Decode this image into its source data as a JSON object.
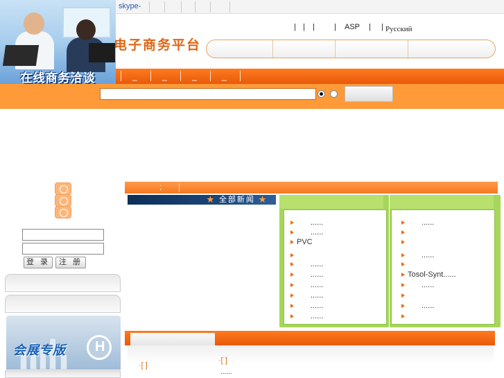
{
  "topbar": {
    "skype": "skype-"
  },
  "promo": {
    "title": "在线商务洽谈"
  },
  "header": {
    "logo": "电子商务平台",
    "link_asp": "ASP",
    "link_ru": "Русский",
    "pipes": [
      "|",
      "|",
      "|",
      "|",
      "|",
      "|"
    ]
  },
  "nav": {
    "items": [
      "_",
      "_",
      "_",
      "_"
    ]
  },
  "search": {
    "value": "",
    "selected_option": 0
  },
  "sidebar": {
    "login_label": "登 录",
    "register_label": "注 册",
    "expo_title": "会展专版"
  },
  "main": {
    "header_mark": ";",
    "news_label": "全部新闻",
    "news_star": "★",
    "left_list": [
      "......",
      "......",
      "PVC",
      "",
      "......",
      "......",
      "......",
      "......",
      "......",
      "......"
    ],
    "right_list": [
      "......",
      "",
      "",
      "......",
      "",
      "Tosol-Synt......",
      "......",
      "",
      "......",
      ""
    ],
    "bottom_left": "·[ ]",
    "bottom_mid": "·[ ]",
    "bottom_mid_sub": "......"
  },
  "colors": {
    "orange": "#f6781e",
    "green": "#a6d65a",
    "navy": "#0d2f58"
  }
}
